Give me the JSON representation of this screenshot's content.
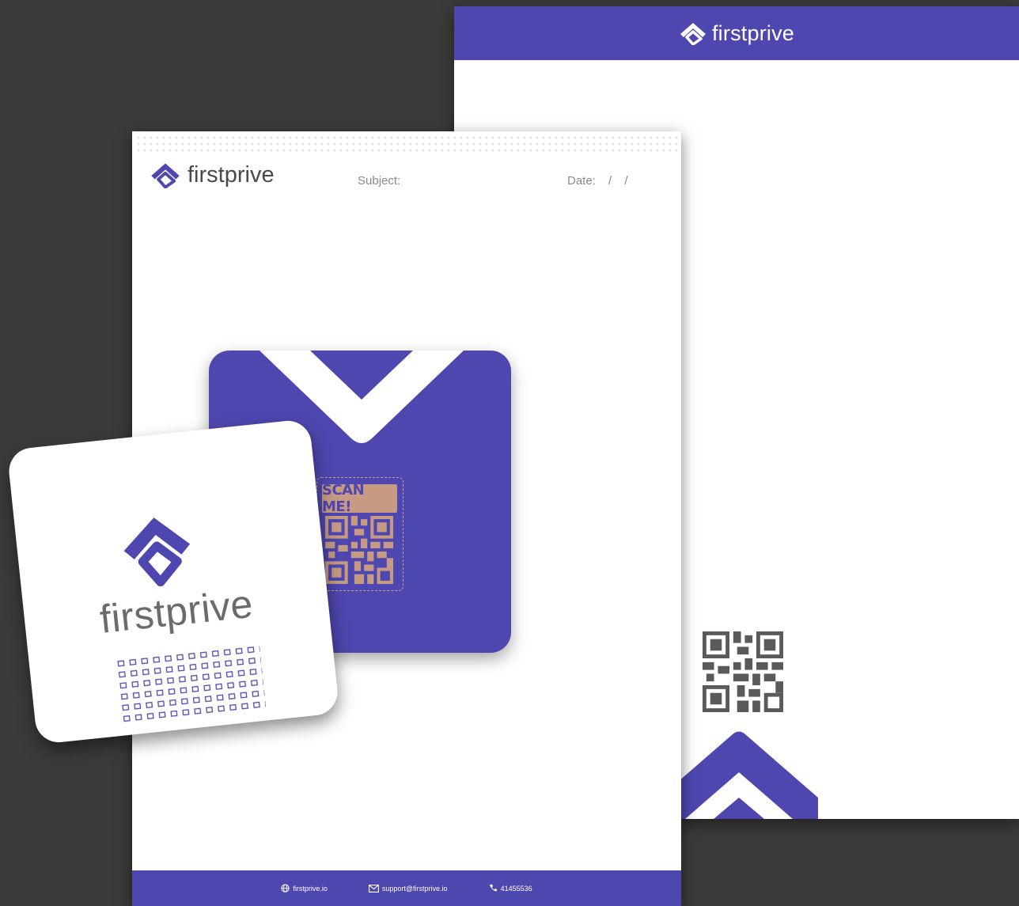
{
  "brand": {
    "name": "firstprive",
    "color": "#4e47b0",
    "accent": "#c69a83"
  },
  "letterhead_front": {
    "subject_label": "Subject:",
    "date_label": "Date: / /",
    "footer": {
      "website": "firstprive.io",
      "email": "support@firstprive.io",
      "phone": "41455536"
    }
  },
  "envelope": {
    "scan_label": "SCAN ME!"
  },
  "icons": [
    "globe-icon",
    "mail-icon",
    "phone-icon",
    "qr-code-icon",
    "logo-icon"
  ]
}
